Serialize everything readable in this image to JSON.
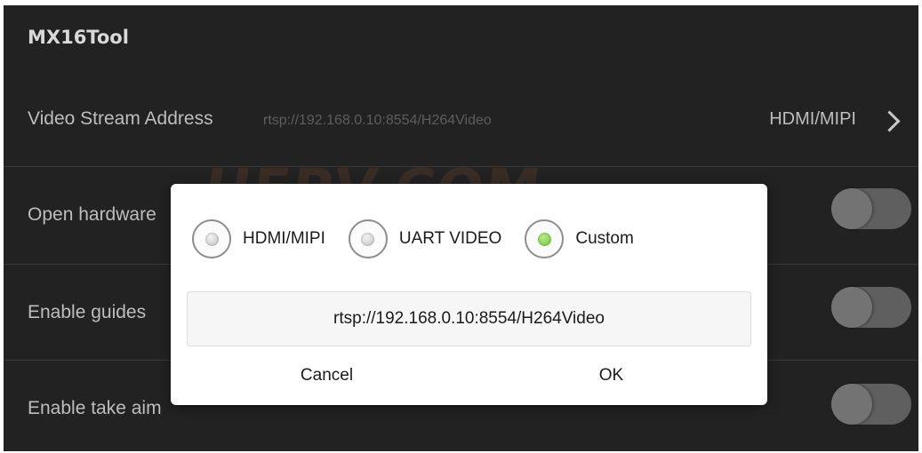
{
  "app": {
    "title": "MX16Tool"
  },
  "rows": [
    {
      "label": "Video Stream Address",
      "value": "rtsp://192.168.0.10:8554/H264Video",
      "mode": "HDMI/MIPI"
    },
    {
      "label": "Open hardware",
      "toggle": "off"
    },
    {
      "label": "Enable guides",
      "toggle": "off"
    },
    {
      "label": "Enable take aim",
      "toggle": "off"
    }
  ],
  "watermark": "HFPV.COM",
  "dialog": {
    "options": [
      {
        "label": "HDMI/MIPI",
        "checked": false
      },
      {
        "label": "UART VIDEO",
        "checked": false
      },
      {
        "label": "Custom",
        "checked": true
      }
    ],
    "url_value": "rtsp://192.168.0.10:8554/H264Video",
    "cancel_label": "Cancel",
    "ok_label": "OK"
  },
  "colors": {
    "accent_green": "#6cc53a",
    "background": "#222222"
  }
}
